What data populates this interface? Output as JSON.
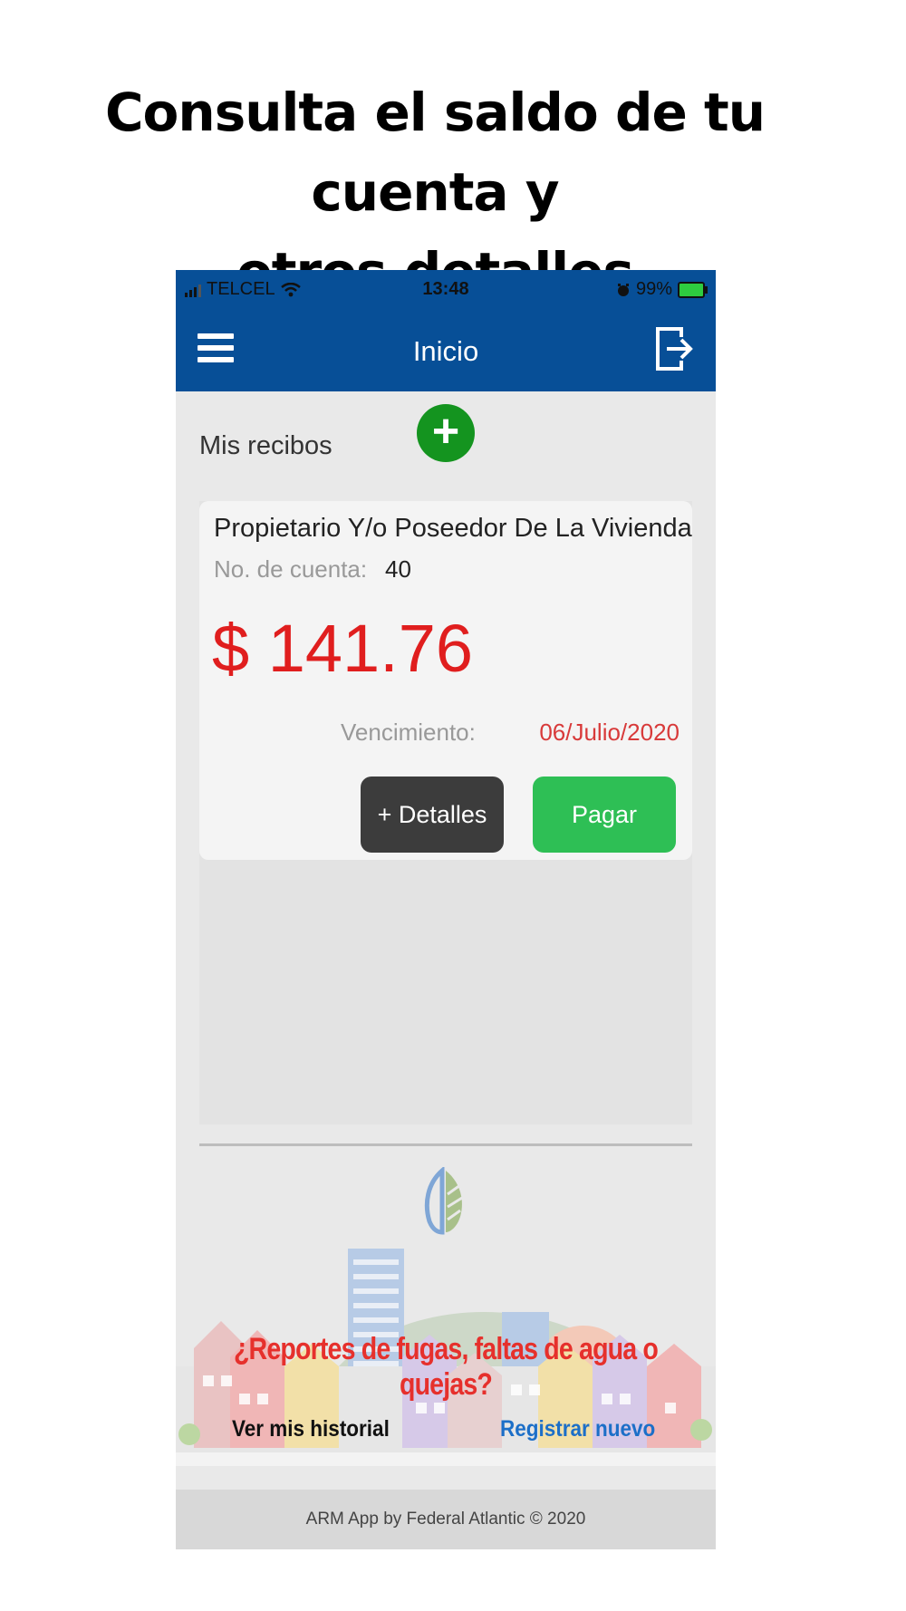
{
  "headline": {
    "line1": "Consulta el saldo de tu cuenta y",
    "line2": "otros detalles"
  },
  "status_bar": {
    "carrier": "TELCEL",
    "time": "13:48",
    "battery": "99%"
  },
  "navbar": {
    "title": "Inicio",
    "menu_icon": "hamburger-icon",
    "logout_icon": "logout-icon"
  },
  "receipts": {
    "section_title": "Mis recibos",
    "add_icon": "plus-icon",
    "add_color": "#14941f"
  },
  "card": {
    "owner": "Propietario Y/o Poseedor De La Vivienda",
    "account_label": "No. de cuenta:",
    "account_value": "40",
    "amount": "$ 141.76",
    "due_label": "Vencimiento:",
    "due_date": "06/Julio/2020",
    "details_button": "+ Detalles",
    "pay_button": "Pagar",
    "amount_color": "#e01e1e",
    "pay_color": "#2ebf55"
  },
  "bottom": {
    "report_question": "¿Reportes de fugas, faltas de agua o quejas?",
    "history_link": "Ver mis historial",
    "register_link": "Registrar nuevo"
  },
  "footer": {
    "text": "ARM App by Federal Atlantic © 2020"
  },
  "colors": {
    "brand_blue": "#074f97"
  }
}
